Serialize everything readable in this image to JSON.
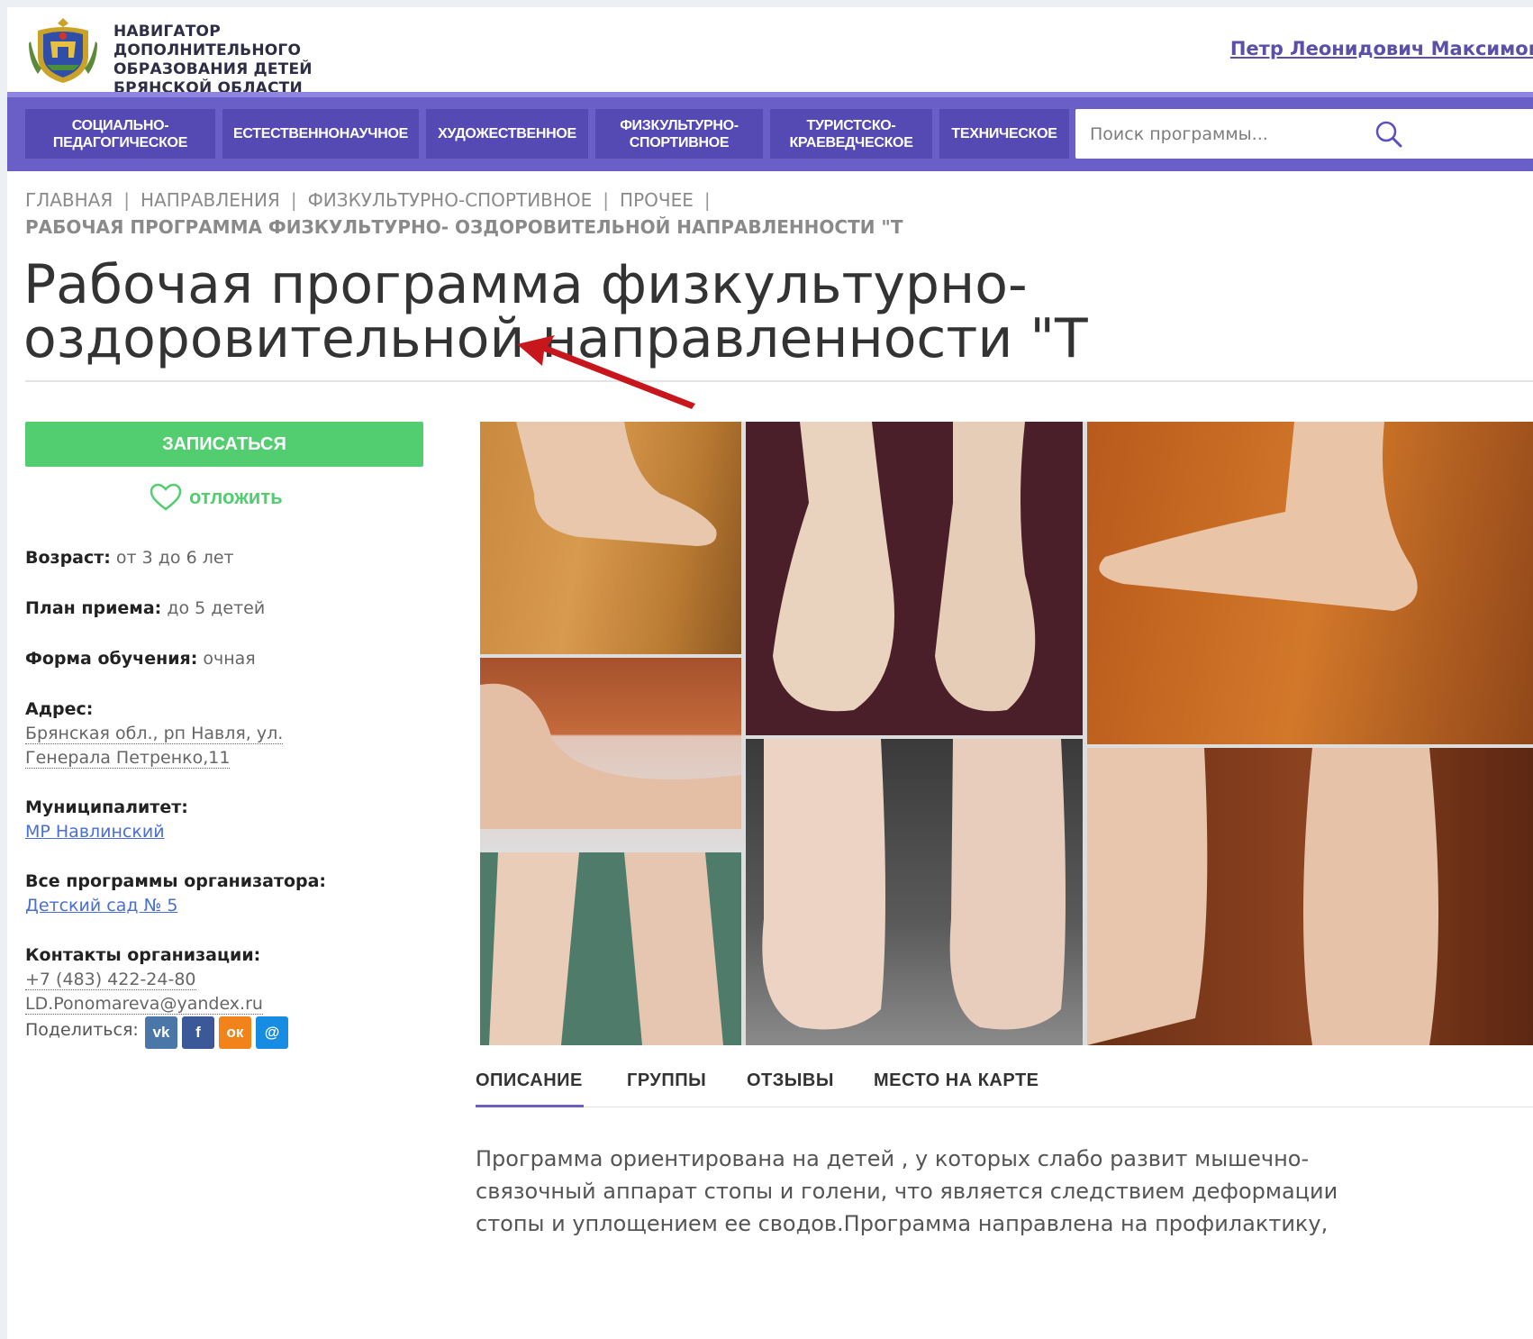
{
  "header": {
    "site_name": "Навигатор дополнительного образования детей Брянской области",
    "user_name": "Петр Леонидович Максимов"
  },
  "nav": {
    "items": [
      {
        "label": "Социально-педагогическое"
      },
      {
        "label": "Естественнонаучное"
      },
      {
        "label": "Художественное"
      },
      {
        "label": "Физкультурно-спортивное"
      },
      {
        "label": "Туристско-краеведческое"
      },
      {
        "label": "Техническое"
      }
    ],
    "search_placeholder": "Поиск программы..."
  },
  "breadcrumbs": {
    "items": [
      "Главная",
      "Направления",
      "Физкультурно-спортивное",
      "Прочее"
    ],
    "current": "Рабочая программа физкультурно- оздоровительной направленности \"Т"
  },
  "page_title": "Рабочая программа физкультурно- оздоровительной направленности \"Т",
  "actions": {
    "enroll_label": "Записаться",
    "postpone_label": "отложить"
  },
  "info": {
    "age_label": "Возраст:",
    "age_value": "от 3 до 6 лет",
    "plan_label": "План приема:",
    "plan_value": "до 5 детей",
    "form_label": "Форма обучения:",
    "form_value": "очная",
    "address_label": "Адрес:",
    "address_value": "Брянская обл., рп Навля, ул. Генерала Петренко,11",
    "municipality_label": "Муниципалитет:",
    "municipality_value": "МР Навлинский",
    "org_programs_label": "Все программы организатора:",
    "org_programs_value": "Детский сад № 5",
    "contacts_label": "Контакты организации:",
    "phone": "+7 (483) 422-24-80",
    "email": "LD.Ponomareva@yandex.ru",
    "share_label": "Поделиться:"
  },
  "social": [
    {
      "icon": "vk-icon",
      "glyph": "vk",
      "color": "#4a76a8"
    },
    {
      "icon": "facebook-icon",
      "glyph": "f",
      "color": "#3b5998"
    },
    {
      "icon": "odnoklassniki-icon",
      "glyph": "ок",
      "color": "#f2821a"
    },
    {
      "icon": "moimir-icon",
      "glyph": "@",
      "color": "#168de2"
    }
  ],
  "tabs": {
    "items": [
      "Описание",
      "Группы",
      "Отзывы",
      "Место на карте"
    ],
    "active": "Описание"
  },
  "description": "Программа ориентирована на детей , у которых слабо развит мышечно-связочный аппарат стопы и голени, что является следствием деформации стопы и уплощением ее сводов.Программа направлена  на профилактику,",
  "colors": {
    "nav_bg": "#6a5fc6",
    "nav_item_bg": "#5549b4",
    "accent_green": "#52cd6f",
    "link": "#4a6fd3",
    "arrow": "#c8161d"
  }
}
